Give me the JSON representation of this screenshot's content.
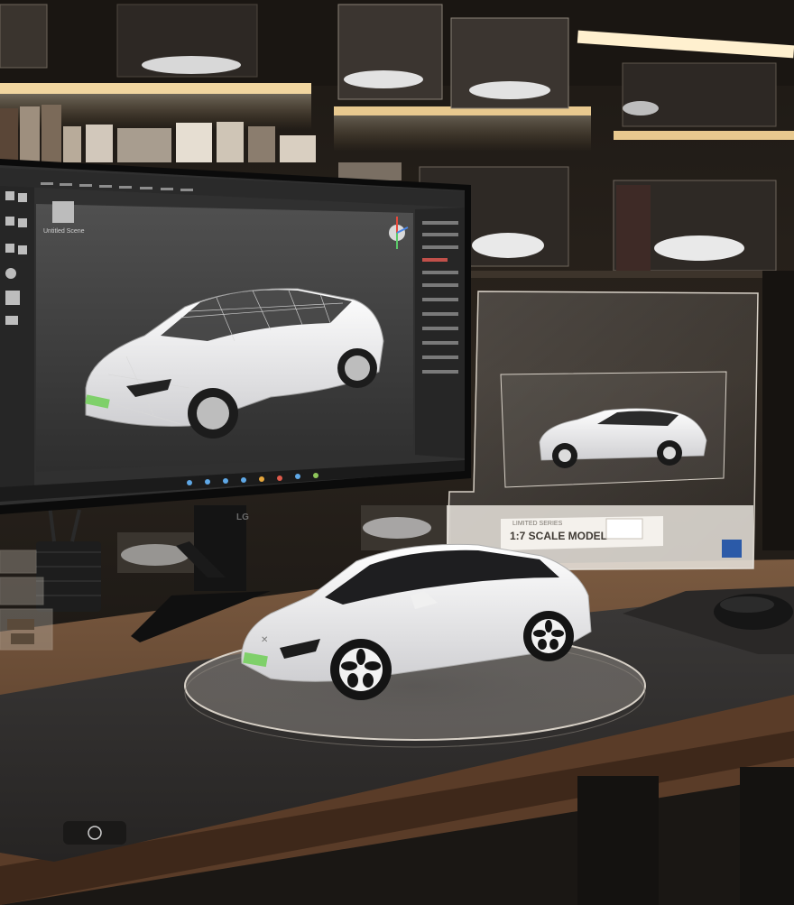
{
  "display_box": {
    "label_small": "LIMITED SERIES",
    "label_main": "1:7 SCALE MODEL"
  },
  "monitor": {
    "brand": "LG",
    "viewport_caption": "Untitled Scene"
  },
  "colors": {
    "wall": "#2a231c",
    "shelf_light": "#f3d9a8",
    "desk_wood": "#6b4a33",
    "desk_mat": "#2f2d2c",
    "car_body": "#eeeeef",
    "plate_green": "#7fd06a",
    "ui_bg": "#3a3a3a",
    "ui_panel": "#262626"
  },
  "icons": [
    "mouse-icon",
    "pen-cup-icon",
    "gizmo-icon"
  ]
}
